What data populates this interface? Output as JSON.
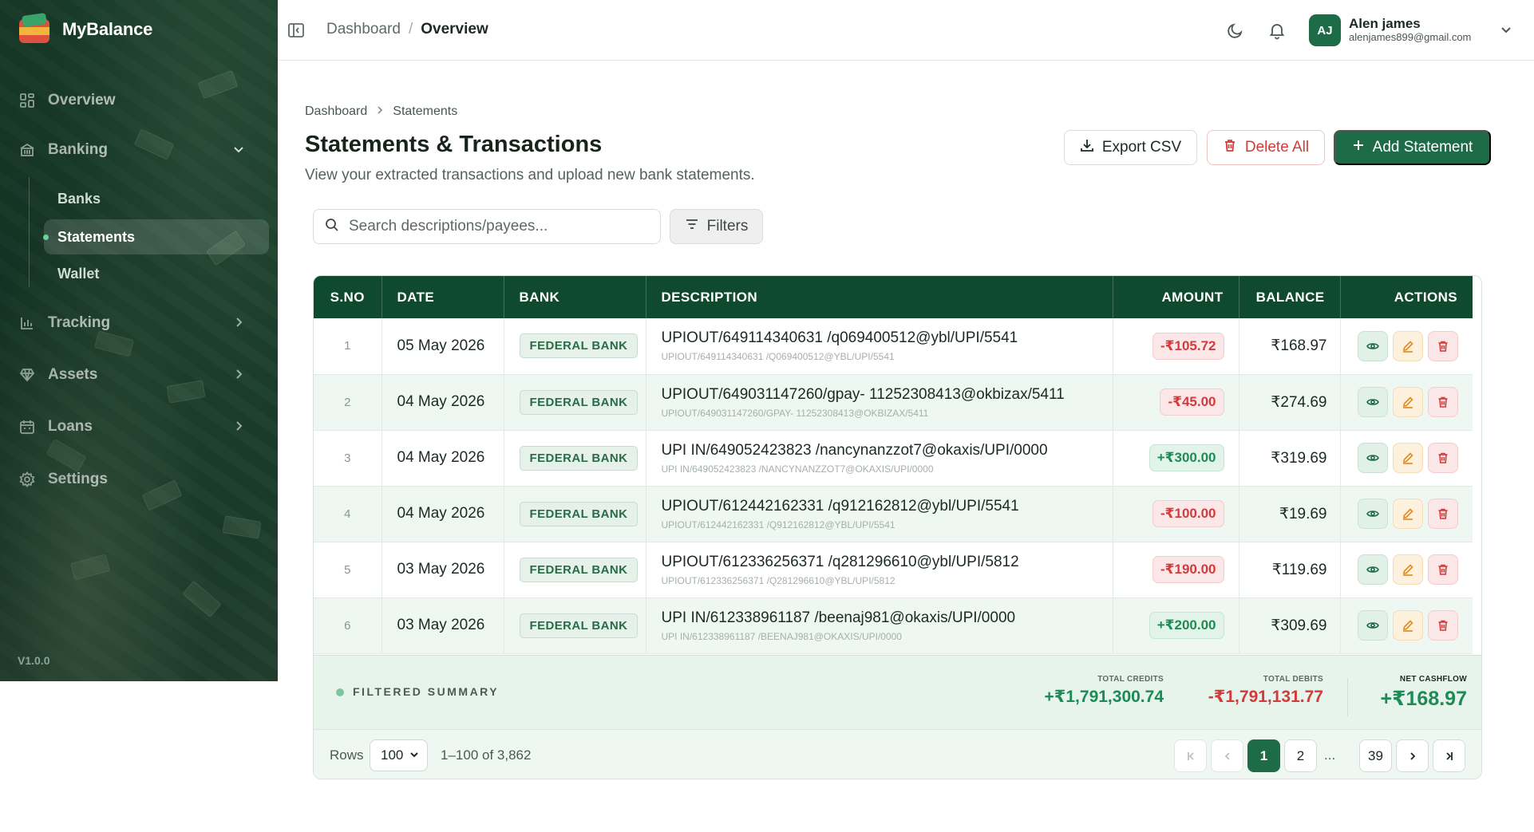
{
  "app": {
    "name": "MyBalance",
    "version": "V1.0.0"
  },
  "sidebar": {
    "items": [
      {
        "label": "Overview",
        "icon": "dashboard-grid-icon"
      },
      {
        "label": "Banking",
        "icon": "bank-icon",
        "expanded": true
      },
      {
        "label": "Tracking",
        "icon": "bar-chart-icon"
      },
      {
        "label": "Assets",
        "icon": "gem-icon"
      },
      {
        "label": "Loans",
        "icon": "calendar-icon"
      },
      {
        "label": "Settings",
        "icon": "gear-icon"
      }
    ],
    "banking_sub": [
      {
        "label": "Banks"
      },
      {
        "label": "Statements",
        "active": true
      },
      {
        "label": "Wallet"
      }
    ]
  },
  "topbar": {
    "crumb_root": "Dashboard",
    "crumb_sep": "/",
    "crumb_current": "Overview",
    "user": {
      "initials": "AJ",
      "name": "Alen james",
      "email": "alenjames899@gmail.com"
    }
  },
  "page": {
    "crumb_root": "Dashboard",
    "crumb_current": "Statements",
    "title": "Statements & Transactions",
    "subtitle": "View your extracted transactions and upload new bank statements.",
    "export_label": "Export CSV",
    "delete_label": "Delete All",
    "add_label": "Add Statement",
    "search_placeholder": "Search descriptions/payees...",
    "filters_label": "Filters"
  },
  "table": {
    "columns": [
      "S.NO",
      "DATE",
      "BANK",
      "DESCRIPTION",
      "AMOUNT",
      "BALANCE",
      "ACTIONS"
    ],
    "rows": [
      {
        "sno": "1",
        "date": "05 May 2026",
        "bank": "FEDERAL BANK",
        "desc": "UPIOUT/649114340631 /q069400512@ybl/UPI/5541",
        "desc_sub": "UPIOUT/649114340631 /Q069400512@YBL/UPI/5541",
        "amount": "-₹105.72",
        "type": "debit",
        "balance": "₹168.97"
      },
      {
        "sno": "2",
        "date": "04 May 2026",
        "bank": "FEDERAL BANK",
        "desc": "UPIOUT/649031147260/gpay- 11252308413@okbizax/5411",
        "desc_sub": "UPIOUT/649031147260/GPAY- 11252308413@OKBIZAX/5411",
        "amount": "-₹45.00",
        "type": "debit",
        "balance": "₹274.69"
      },
      {
        "sno": "3",
        "date": "04 May 2026",
        "bank": "FEDERAL BANK",
        "desc": "UPI IN/649052423823 /nancynanzzot7@okaxis/UPI/0000",
        "desc_sub": "UPI IN/649052423823 /NANCYNANZZOT7@OKAXIS/UPI/0000",
        "amount": "+₹300.00",
        "type": "credit",
        "balance": "₹319.69"
      },
      {
        "sno": "4",
        "date": "04 May 2026",
        "bank": "FEDERAL BANK",
        "desc": "UPIOUT/612442162331 /q912162812@ybl/UPI/5541",
        "desc_sub": "UPIOUT/612442162331 /Q912162812@YBL/UPI/5541",
        "amount": "-₹100.00",
        "type": "debit",
        "balance": "₹19.69"
      },
      {
        "sno": "5",
        "date": "03 May 2026",
        "bank": "FEDERAL BANK",
        "desc": "UPIOUT/612336256371 /q281296610@ybl/UPI/5812",
        "desc_sub": "UPIOUT/612336256371 /Q281296610@YBL/UPI/5812",
        "amount": "-₹190.00",
        "type": "debit",
        "balance": "₹119.69"
      },
      {
        "sno": "6",
        "date": "03 May 2026",
        "bank": "FEDERAL BANK",
        "desc": "UPI IN/612338961187 /beenaj981@okaxis/UPI/0000",
        "desc_sub": "UPI IN/612338961187 /BEENAJ981@OKAXIS/UPI/0000",
        "amount": "+₹200.00",
        "type": "credit",
        "balance": "₹309.69"
      }
    ]
  },
  "summary": {
    "label": "FILTERED SUMMARY",
    "credits_label": "TOTAL CREDITS",
    "credits_value": "+₹1,791,300.74",
    "debits_label": "TOTAL DEBITS",
    "debits_value": "-₹1,791,131.77",
    "net_label": "NET CASHFLOW",
    "net_value": "+₹168.97"
  },
  "pagination": {
    "rows_label": "Rows",
    "rows_value": "100",
    "range": "1–100 of 3,862",
    "pages": [
      "1",
      "2",
      "...",
      "39"
    ],
    "current": "1"
  },
  "colors": {
    "brand": "#1e6b47",
    "header": "#0f4a2f",
    "debit": "#d23b3b",
    "credit": "#1e8a55"
  }
}
